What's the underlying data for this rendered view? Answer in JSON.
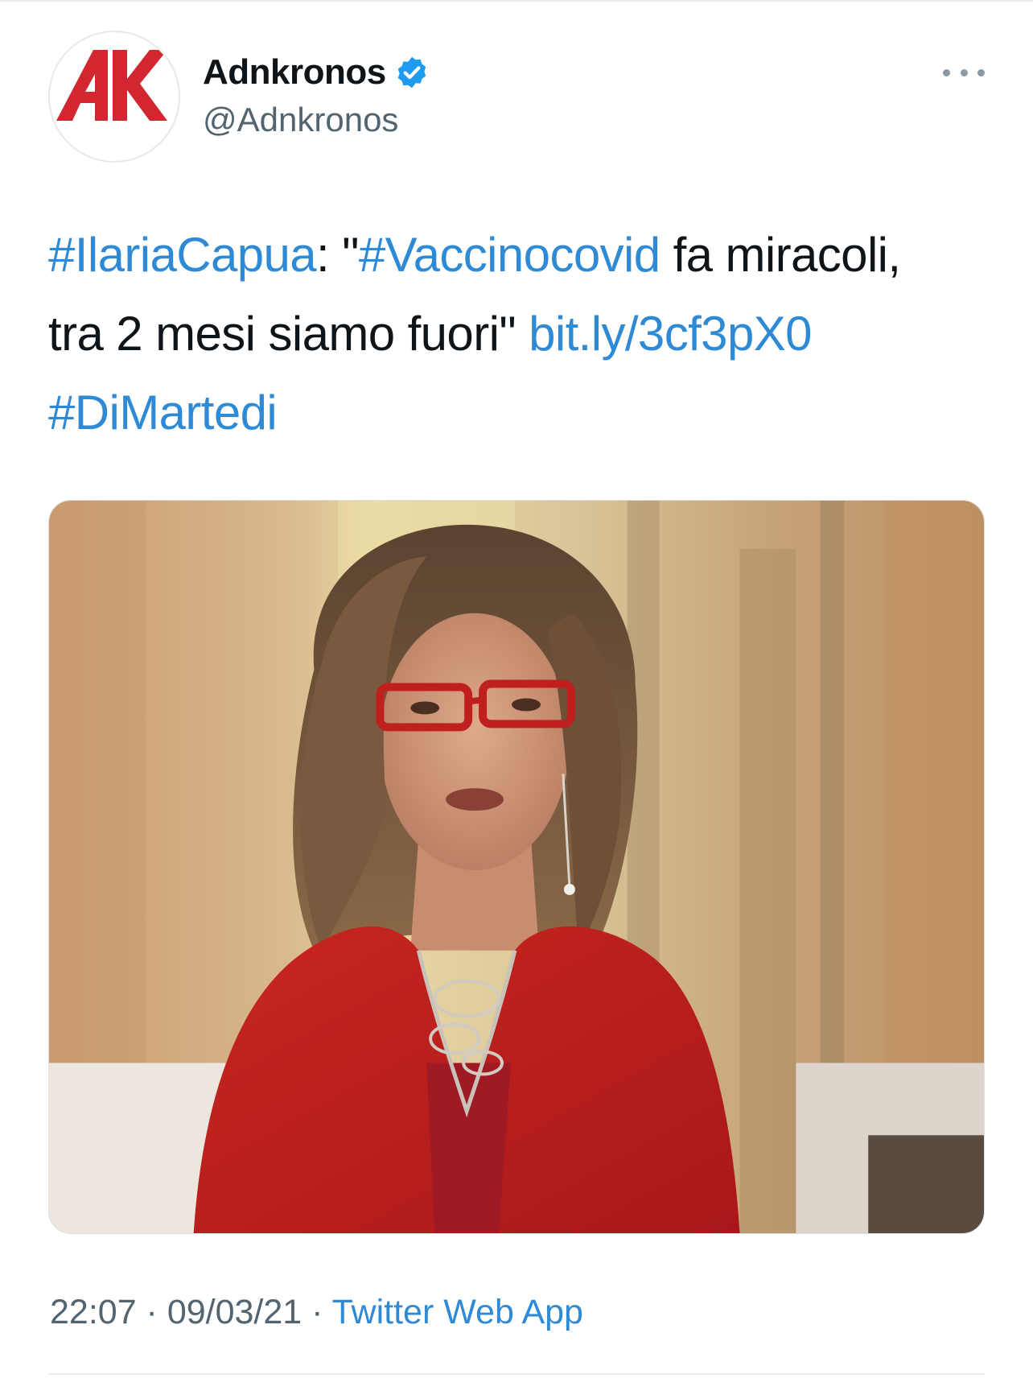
{
  "author": {
    "display_name": "Adnkronos",
    "handle": "@Adnkronos",
    "verified": true,
    "avatar_icon": "adnkronos-logo",
    "brand_color": "#d22630"
  },
  "tweet": {
    "segments": [
      {
        "text": "#IlariaCapua",
        "link": true
      },
      {
        "text": ": \"",
        "link": false
      },
      {
        "text": "#Vaccinocovid",
        "link": true
      },
      {
        "text": " fa miracoli, tra 2 mesi siamo fuori\" ",
        "link": false
      },
      {
        "text": "bit.ly/3cf3pX0",
        "link": true
      },
      {
        "text": " ",
        "link": false
      },
      {
        "text": "#DiMartedi",
        "link": true
      }
    ],
    "media": {
      "icon": "photo-woman-red-jacket"
    }
  },
  "meta": {
    "time": "22:07",
    "separator": " · ",
    "date": "09/03/21",
    "source": "Twitter Web App"
  },
  "colors": {
    "link": "#2f8ad6",
    "secondary_text": "#536471",
    "verified": "#1d9bf0"
  },
  "menu_icon": "more-options-icon"
}
